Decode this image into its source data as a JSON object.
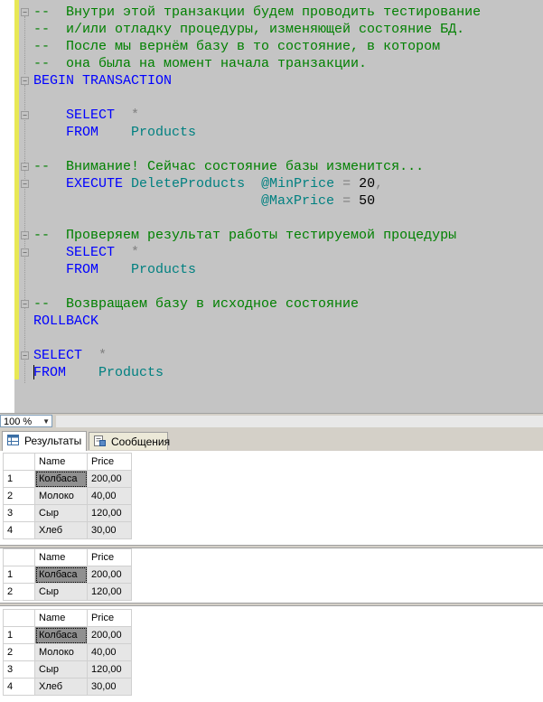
{
  "editor": {
    "lines": [
      [
        {
          "c": "cm",
          "t": "--  Внутри этой транзакции будем проводить тестирование"
        }
      ],
      [
        {
          "c": "cm",
          "t": "--  и/или отладку процедуры, изменяющей состояние БД."
        }
      ],
      [
        {
          "c": "cm",
          "t": "--  После мы вернём базу в то состояние, в котором"
        }
      ],
      [
        {
          "c": "cm",
          "t": "--  она была на момент начала транзакции."
        }
      ],
      [
        {
          "c": "kw",
          "t": "BEGIN TRANSACTION"
        }
      ],
      [],
      [
        {
          "c": "",
          "t": "    "
        },
        {
          "c": "kw",
          "t": "SELECT"
        },
        {
          "c": "",
          "t": "  "
        },
        {
          "c": "op",
          "t": "*"
        }
      ],
      [
        {
          "c": "",
          "t": "    "
        },
        {
          "c": "kw",
          "t": "FROM"
        },
        {
          "c": "",
          "t": "    "
        },
        {
          "c": "id",
          "t": "Products"
        }
      ],
      [],
      [
        {
          "c": "cm",
          "t": "--  Внимание! Сейчас состояние базы изменится..."
        }
      ],
      [
        {
          "c": "",
          "t": "    "
        },
        {
          "c": "kw",
          "t": "EXECUTE"
        },
        {
          "c": "",
          "t": " "
        },
        {
          "c": "id",
          "t": "DeleteProducts"
        },
        {
          "c": "",
          "t": "  "
        },
        {
          "c": "id",
          "t": "@MinPrice"
        },
        {
          "c": "",
          "t": " "
        },
        {
          "c": "op",
          "t": "="
        },
        {
          "c": "",
          "t": " "
        },
        {
          "c": "num",
          "t": "20"
        },
        {
          "c": "op",
          "t": ","
        }
      ],
      [
        {
          "c": "",
          "t": "                            "
        },
        {
          "c": "id",
          "t": "@MaxPrice"
        },
        {
          "c": "",
          "t": " "
        },
        {
          "c": "op",
          "t": "="
        },
        {
          "c": "",
          "t": " "
        },
        {
          "c": "num",
          "t": "50"
        }
      ],
      [],
      [
        {
          "c": "cm",
          "t": "--  Проверяем результат работы тестируемой процедуры"
        }
      ],
      [
        {
          "c": "",
          "t": "    "
        },
        {
          "c": "kw",
          "t": "SELECT"
        },
        {
          "c": "",
          "t": "  "
        },
        {
          "c": "op",
          "t": "*"
        }
      ],
      [
        {
          "c": "",
          "t": "    "
        },
        {
          "c": "kw",
          "t": "FROM"
        },
        {
          "c": "",
          "t": "    "
        },
        {
          "c": "id",
          "t": "Products"
        }
      ],
      [],
      [
        {
          "c": "cm",
          "t": "--  Возвращаем базу в исходное состояние"
        }
      ],
      [
        {
          "c": "kw",
          "t": "ROLLBACK"
        }
      ],
      [],
      [
        {
          "c": "kw",
          "t": "SELECT"
        },
        {
          "c": "",
          "t": "  "
        },
        {
          "c": "op",
          "t": "*"
        }
      ],
      [
        {
          "c": "caret",
          "t": ""
        },
        {
          "c": "kw",
          "t": "FROM"
        },
        {
          "c": "",
          "t": "    "
        },
        {
          "c": "id",
          "t": "Products"
        }
      ]
    ]
  },
  "zoom": {
    "value": "100 %"
  },
  "tabs": {
    "results": "Результаты",
    "messages": "Сообщения"
  },
  "grids": [
    {
      "headers": [
        "Name",
        "Price"
      ],
      "rows": [
        [
          "1",
          "Колбаса",
          "200,00"
        ],
        [
          "2",
          "Молоко",
          "40,00"
        ],
        [
          "3",
          "Сыр",
          "120,00"
        ],
        [
          "4",
          "Хлеб",
          "30,00"
        ]
      ]
    },
    {
      "headers": [
        "Name",
        "Price"
      ],
      "rows": [
        [
          "1",
          "Колбаса",
          "200,00"
        ],
        [
          "2",
          "Сыр",
          "120,00"
        ]
      ]
    },
    {
      "headers": [
        "Name",
        "Price"
      ],
      "rows": [
        [
          "1",
          "Колбаса",
          "200,00"
        ],
        [
          "2",
          "Молоко",
          "40,00"
        ],
        [
          "3",
          "Сыр",
          "120,00"
        ],
        [
          "4",
          "Хлеб",
          "30,00"
        ]
      ]
    }
  ]
}
